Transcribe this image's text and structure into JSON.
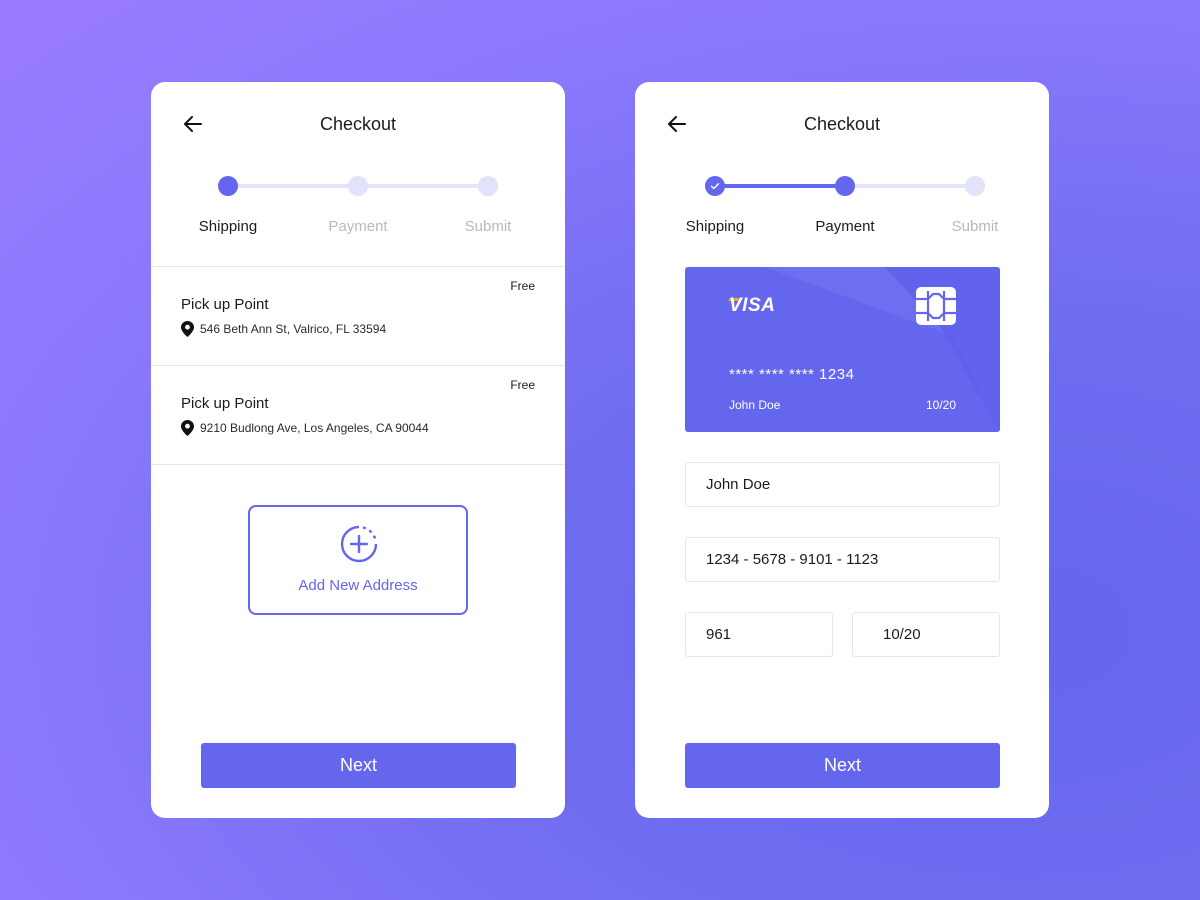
{
  "colors": {
    "accent": "#6466ee",
    "track": "#e4e4fb",
    "muted": "#b8b8c4"
  },
  "shipping_screen": {
    "title": "Checkout",
    "back_icon": "arrow-left-icon",
    "steps": [
      {
        "label": "Shipping",
        "state": "active"
      },
      {
        "label": "Payment",
        "state": "pending"
      },
      {
        "label": "Submit",
        "state": "pending"
      }
    ],
    "addresses": [
      {
        "title": "Pick up Point",
        "address": "546 Beth Ann St, Valrico, FL 33594",
        "price": "Free",
        "icon": "location-pin-icon"
      },
      {
        "title": "Pick up Point",
        "address": "9210 Budlong Ave, Los Angeles, CA 90044",
        "price": "Free",
        "icon": "location-pin-icon"
      }
    ],
    "add_address": {
      "label": "Add New Address",
      "icon": "plus-circle-icon"
    },
    "next_label": "Next"
  },
  "payment_screen": {
    "title": "Checkout",
    "back_icon": "arrow-left-icon",
    "steps": [
      {
        "label": "Shipping",
        "state": "done"
      },
      {
        "label": "Payment",
        "state": "active"
      },
      {
        "label": "Submit",
        "state": "pending"
      }
    ],
    "card": {
      "brand": "VISA",
      "number_masked": "****  ****  ****  1234",
      "holder": "John Doe",
      "expiry": "10/20",
      "chip_icon": "card-chip-icon"
    },
    "form": {
      "name": "John Doe",
      "number": "1234 - 5678 - 9101 - 1123",
      "cvv": "961",
      "expiry": "10/20"
    },
    "next_label": "Next"
  }
}
